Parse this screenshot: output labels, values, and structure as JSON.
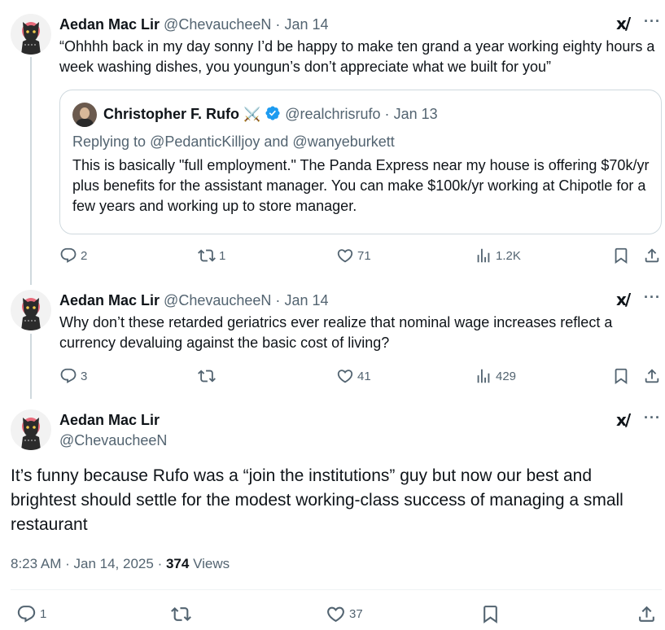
{
  "tweet1": {
    "name": "Aedan Mac Lir",
    "handle": "@ChevaucheeN",
    "sep": "·",
    "date": "Jan 14",
    "text": "“Ohhhh back in my day sonny I’d be happy to make ten grand a year working eighty hours a week washing dishes, you youngun’s don’t appreciate what we built for you”",
    "quote": {
      "name": "Christopher F. Rufo",
      "emoji": "⚔️",
      "handle": "@realchrisrufo",
      "sep": "·",
      "date": "Jan 13",
      "reply_prefix": "Replying to ",
      "reply_to": "@PedanticKilljoy and @wanyeburkett",
      "text": "This is basically \"full employment.\" The Panda Express near my house is offering $70k/yr plus benefits for the assistant manager. You can make $100k/yr working at Chipotle for a few years and working up to store manager."
    },
    "replies": "2",
    "reposts": "1",
    "likes": "71",
    "views": "1.2K"
  },
  "tweet2": {
    "name": "Aedan Mac Lir",
    "handle": "@ChevaucheeN",
    "sep": "·",
    "date": "Jan 14",
    "text": "Why don’t these retarded geriatrics ever realize that nominal wage increases reflect a currency devaluing against the basic cost of living?",
    "replies": "3",
    "reposts": "",
    "likes": "41",
    "views": "429"
  },
  "main_tweet": {
    "name": "Aedan Mac Lir",
    "handle": "@ChevaucheeN",
    "text": "It’s funny because Rufo was a “join the institutions” guy but now our best and brightest should settle for the modest working-class success of managing a small restaurant",
    "time": "8:23 AM",
    "sep1": "·",
    "date": "Jan 14, 2025",
    "sep2": "·",
    "views_count": "374",
    "views_label": "Views",
    "replies": "1",
    "likes": "37"
  },
  "icons": {
    "grok": "grok-icon",
    "more": "more-icon",
    "reply": "reply-icon",
    "repost": "repost-icon",
    "like": "heart-icon",
    "views": "views-icon",
    "bookmark": "bookmark-icon",
    "share": "share-icon",
    "verified": "verified-badge-icon"
  },
  "colors": {
    "text": "#0f1419",
    "secondary": "#536471",
    "border": "#cfd9de",
    "verified": "#1d9bf0",
    "avatar_bg": "#e86a7a"
  }
}
